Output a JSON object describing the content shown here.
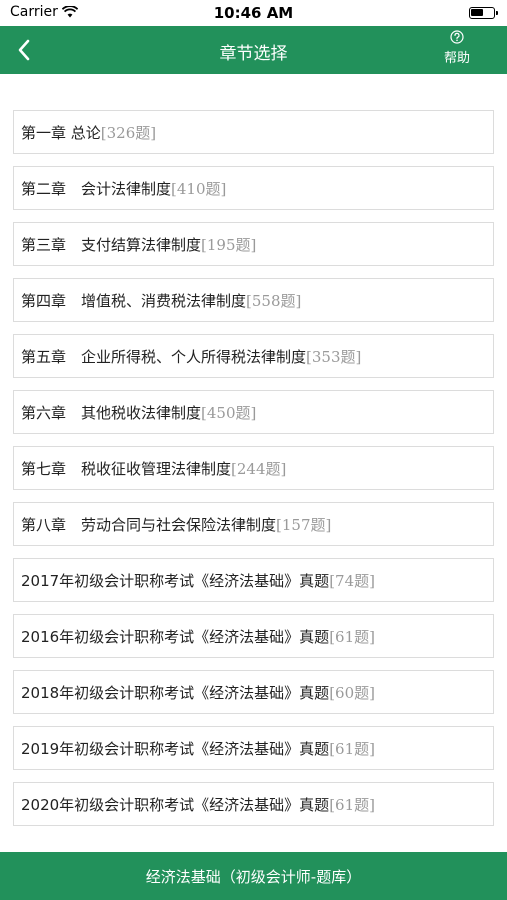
{
  "status_bar": {
    "carrier": "Carrier",
    "time": "10:46 AM"
  },
  "nav": {
    "title": "章节选择",
    "help_label": "帮助"
  },
  "chapters": [
    {
      "title": "第一章 总论",
      "count": "[326题]"
    },
    {
      "title": "第二章　会计法律制度",
      "count": "[410题]"
    },
    {
      "title": "第三章　支付结算法律制度",
      "count": "[195题]"
    },
    {
      "title": "第四章　增值税、消费税法律制度",
      "count": "[558题]"
    },
    {
      "title": "第五章　企业所得税、个人所得税法律制度",
      "count": "[353题]"
    },
    {
      "title": "第六章　其他税收法律制度",
      "count": "[450题]"
    },
    {
      "title": "第七章　税收征收管理法律制度",
      "count": "[244题]"
    },
    {
      "title": "第八章　劳动合同与社会保险法律制度",
      "count": "[157题]"
    },
    {
      "title": "2017年初级会计职称考试《经济法基础》真题",
      "count": "[74题]"
    },
    {
      "title": "2016年初级会计职称考试《经济法基础》真题",
      "count": "[61题]"
    },
    {
      "title": "2018年初级会计职称考试《经济法基础》真题",
      "count": "[60题]"
    },
    {
      "title": "2019年初级会计职称考试《经济法基础》真题",
      "count": "[61题]"
    },
    {
      "title": "2020年初级会计职称考试《经济法基础》真题",
      "count": "[61题]"
    }
  ],
  "bottom_bar": {
    "label": "经济法基础（初级会计师-题库）"
  },
  "colors": {
    "accent": "#22915b",
    "count_text": "#9a9a9a",
    "border": "#dcdcdc"
  },
  "icons": {
    "back": "chevron-left-icon",
    "help": "question-circle-icon",
    "wifi": "wifi-icon",
    "battery": "battery-icon"
  }
}
